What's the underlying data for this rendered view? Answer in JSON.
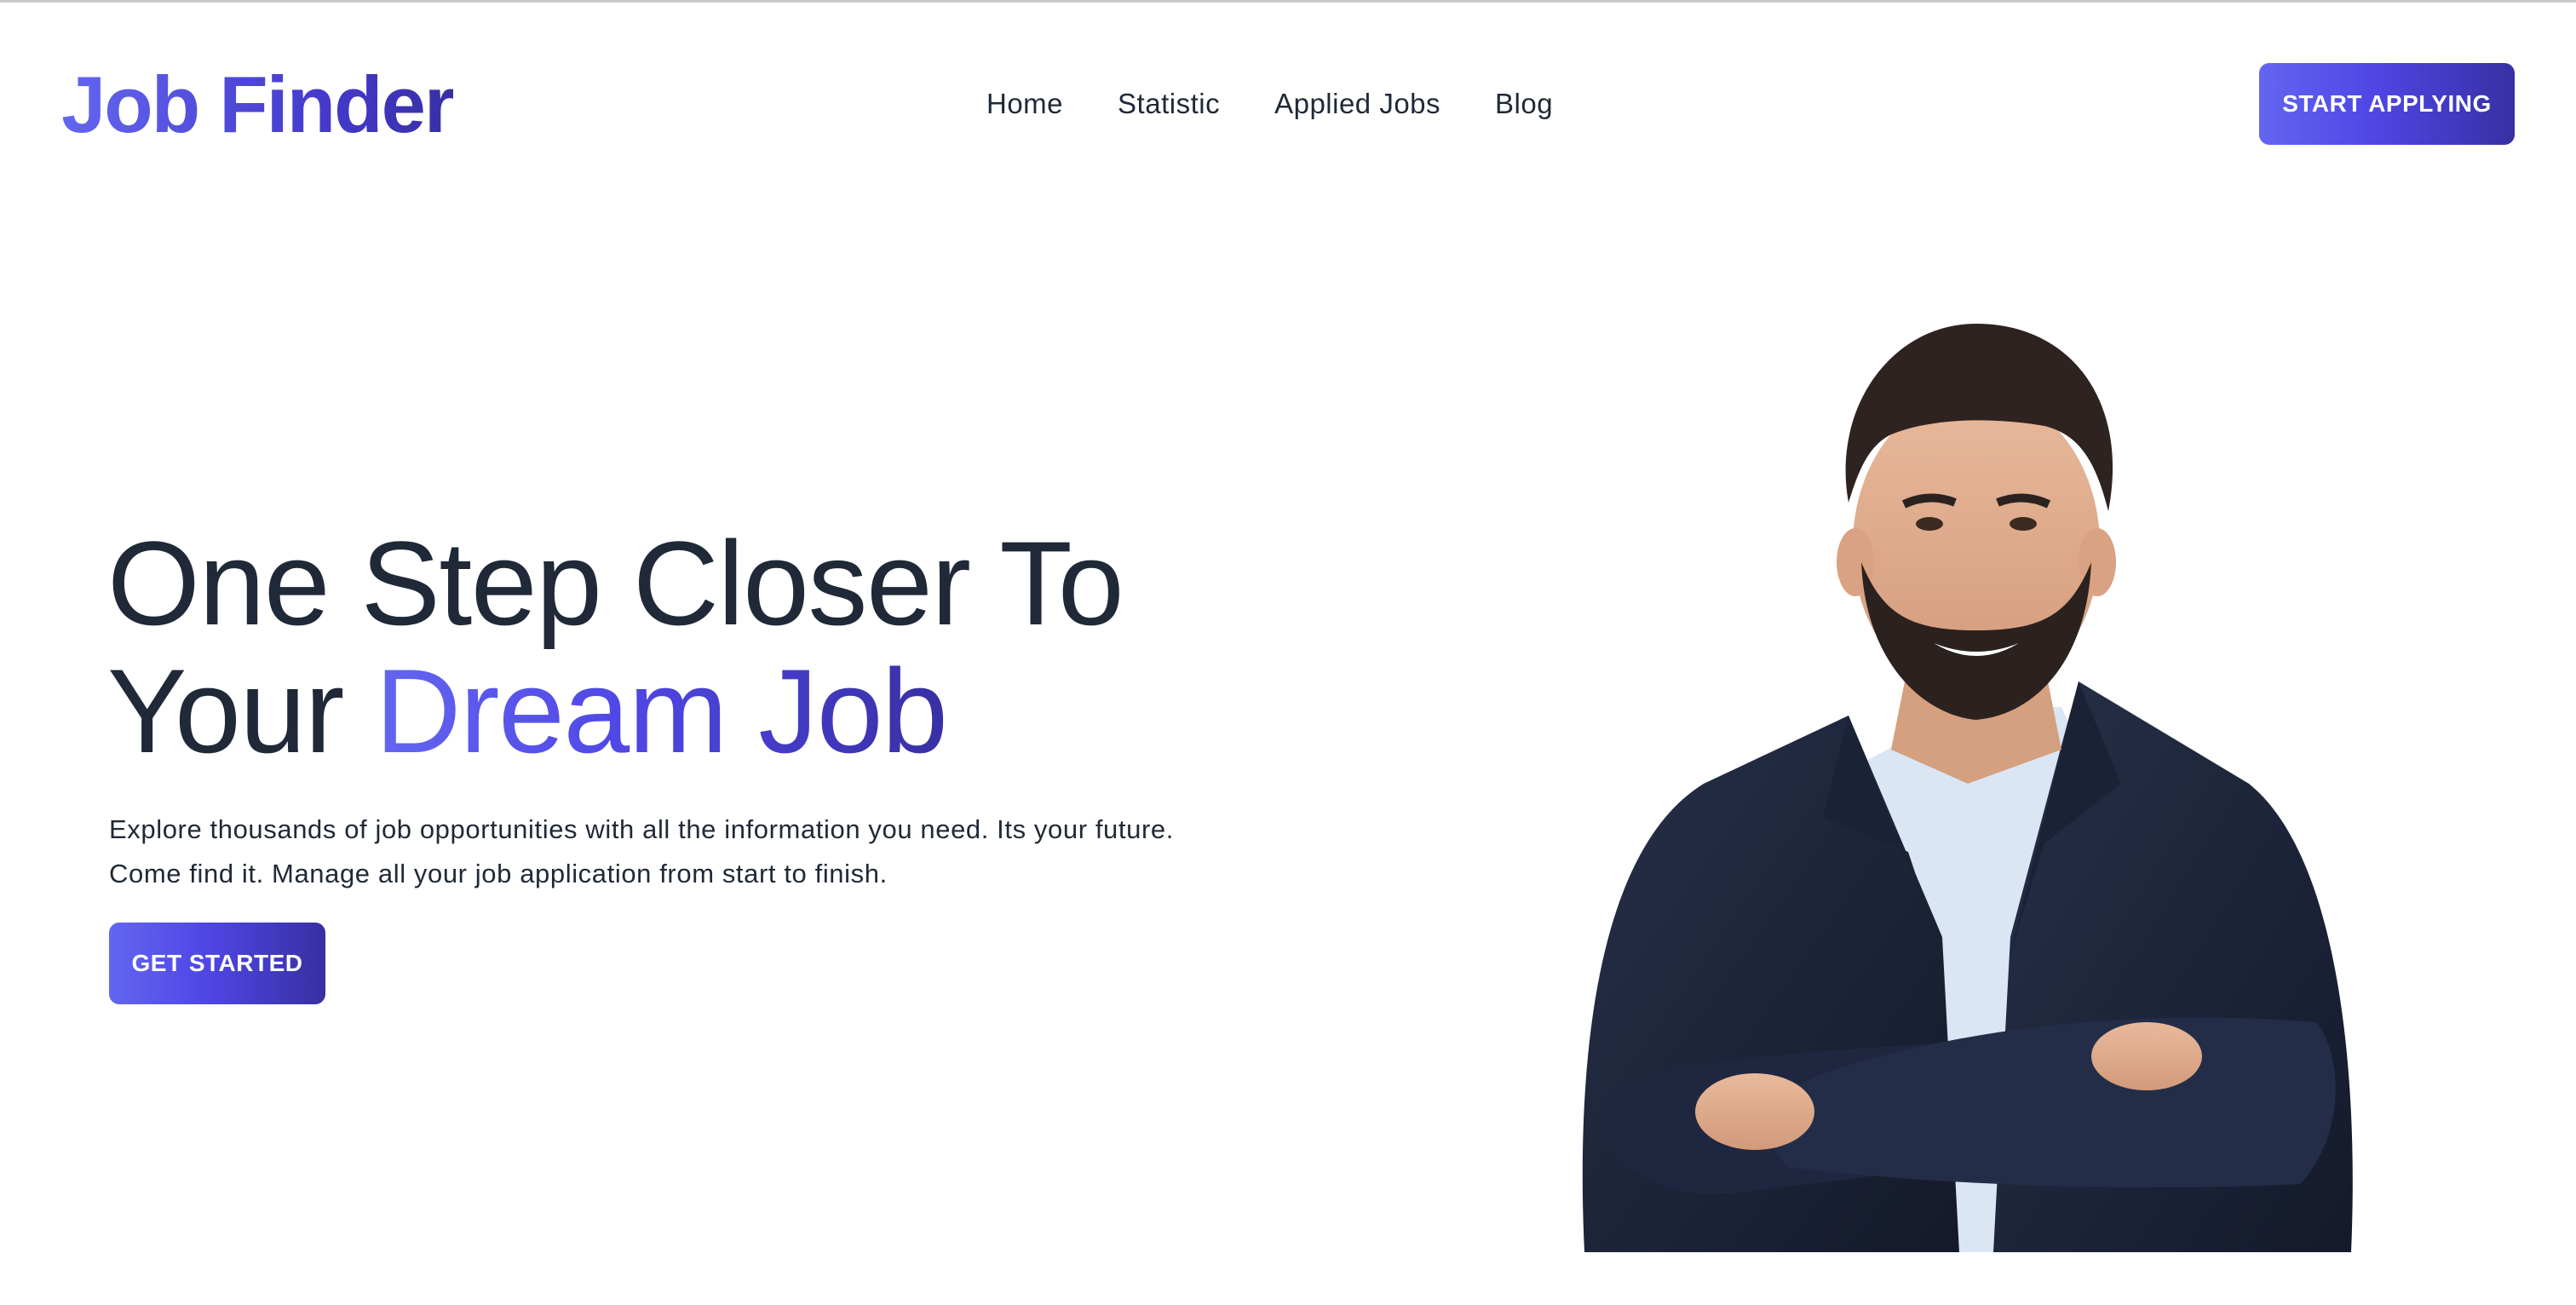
{
  "header": {
    "brand": "Job Finder",
    "nav": [
      {
        "label": "Home"
      },
      {
        "label": "Statistic"
      },
      {
        "label": "Applied Jobs"
      },
      {
        "label": "Blog"
      }
    ],
    "cta_label": "START APPLYING"
  },
  "hero": {
    "title_line1": "One Step Closer To",
    "title_line2_prefix": "Your ",
    "title_line2_accent": "Dream Job",
    "description": "Explore thousands of job opportunities with all the information you need. Its your future. Come find it. Manage all your job application from start to finish.",
    "cta_label": "GET STARTED"
  },
  "colors": {
    "accent_start": "#6366f1",
    "accent_end": "#3730a3",
    "text": "#1f2937",
    "background": "#ffffff"
  },
  "icons": {
    "portrait": "person-portrait-image"
  }
}
